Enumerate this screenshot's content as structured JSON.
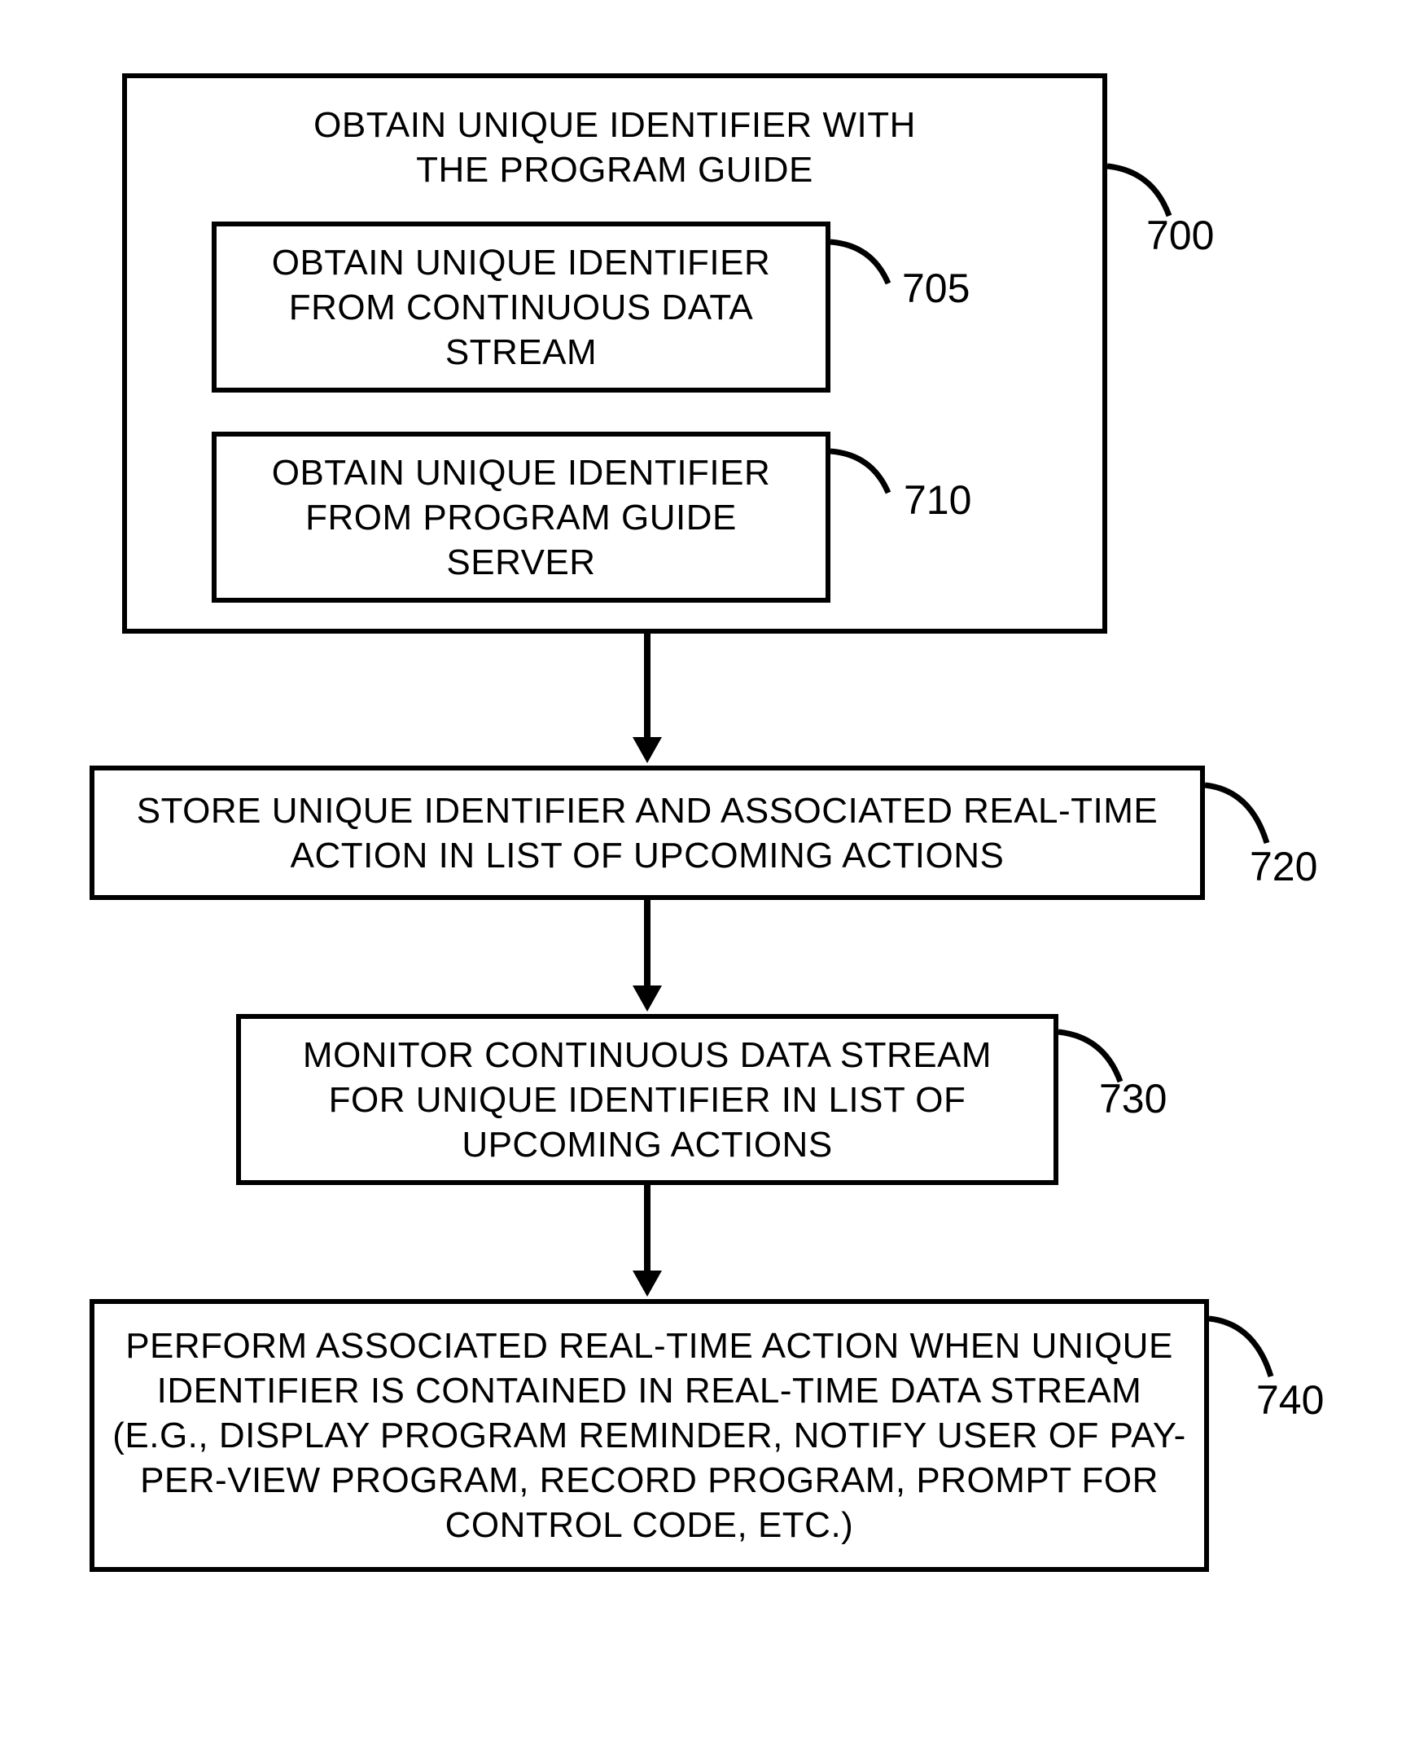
{
  "flow": {
    "box700": {
      "title": "OBTAIN UNIQUE IDENTIFIER WITH THE PROGRAM GUIDE",
      "label": "700"
    },
    "box705": {
      "text": "OBTAIN UNIQUE IDENTIFIER FROM CONTINUOUS DATA STREAM",
      "label": "705"
    },
    "box710": {
      "text": "OBTAIN UNIQUE IDENTIFIER FROM PROGRAM GUIDE SERVER",
      "label": "710"
    },
    "box720": {
      "text": "STORE UNIQUE IDENTIFIER AND ASSOCIATED REAL-TIME ACTION IN LIST OF UPCOMING ACTIONS",
      "label": "720"
    },
    "box730": {
      "text": "MONITOR CONTINUOUS DATA STREAM FOR UNIQUE IDENTIFIER IN LIST OF UPCOMING ACTIONS",
      "label": "730"
    },
    "box740": {
      "text": "PERFORM ASSOCIATED REAL-TIME ACTION WHEN UNIQUE IDENTIFIER IS CONTAINED IN REAL-TIME DATA STREAM (E.G., DISPLAY PROGRAM REMINDER, NOTIFY USER OF PAY-PER-VIEW PROGRAM, RECORD PROGRAM, PROMPT FOR CONTROL CODE, ETC.)",
      "label": "740"
    }
  }
}
